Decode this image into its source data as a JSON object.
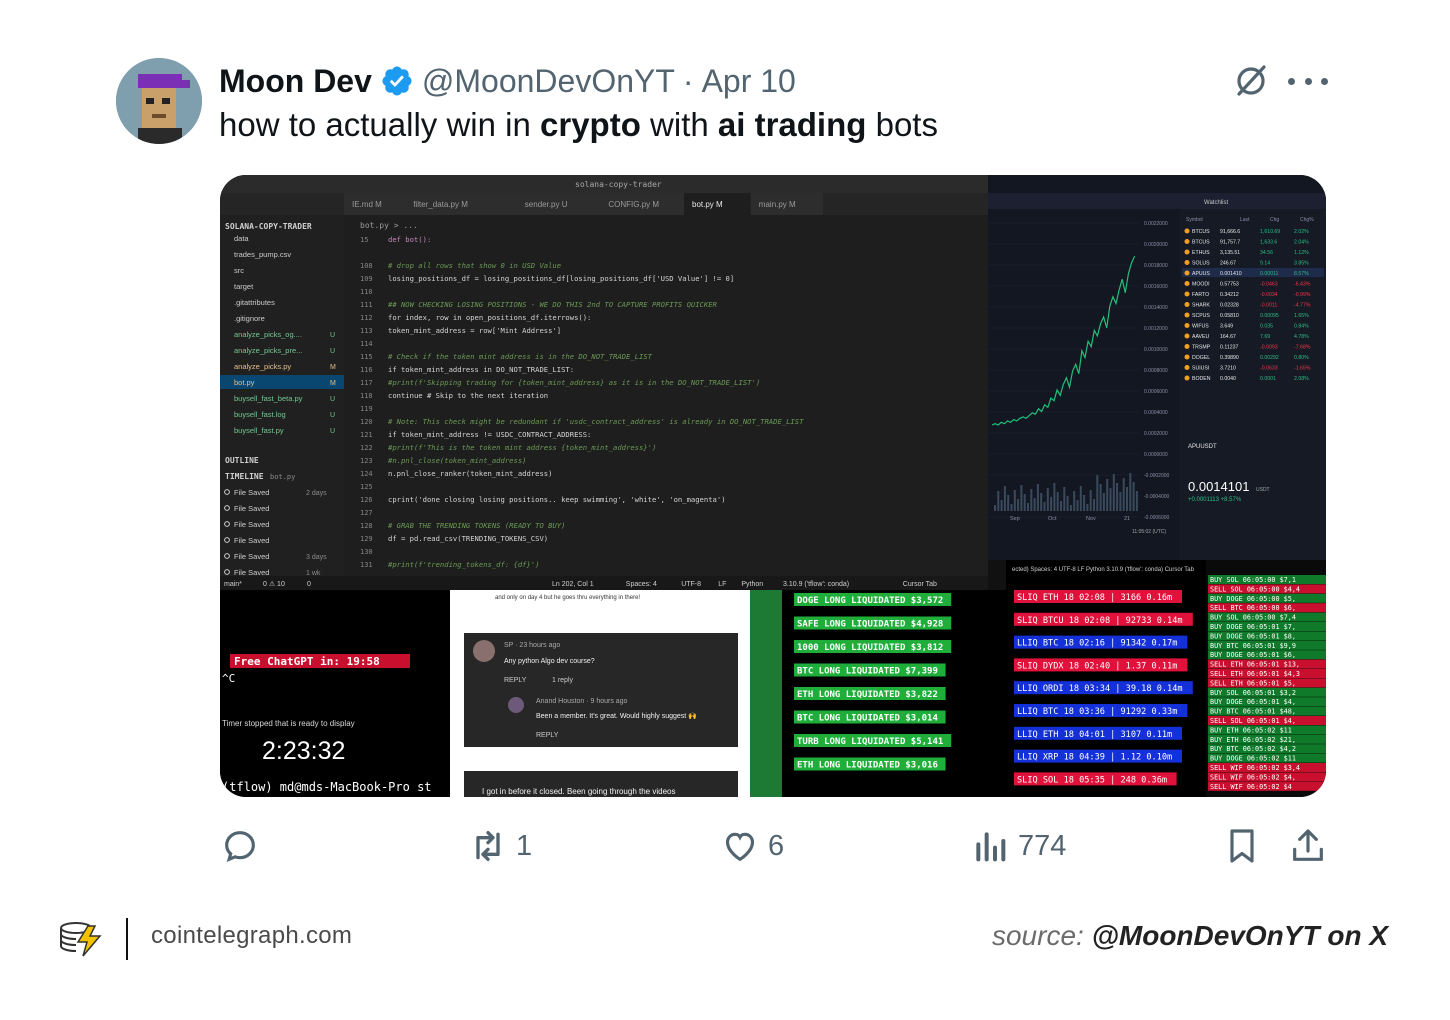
{
  "tweet": {
    "display_name": "Moon Dev",
    "handle": "@MoonDevOnYT",
    "separator": "·",
    "date": "Apr 10",
    "text_parts": [
      "how to actually win in ",
      "crypto",
      " with ",
      "ai trading",
      " bots"
    ]
  },
  "media": {
    "editor": {
      "window_title": "solana-copy-trader",
      "explorer_title": "SOLANA-COPY-TRADER",
      "tabs": [
        "IE.md M",
        "filter_data.py M",
        "sender.py U",
        "CONFIG.py M",
        "bot.py M",
        "main.py M"
      ],
      "breadcrumb": "bot.py > ...",
      "files": [
        {
          "name": "data",
          "badge": ""
        },
        {
          "name": "trades_pump.csv",
          "badge": ""
        },
        {
          "name": "src",
          "badge": ""
        },
        {
          "name": "target",
          "badge": ""
        },
        {
          "name": ".gitattributes",
          "badge": ""
        },
        {
          "name": ".gitignore",
          "badge": ""
        },
        {
          "name": "analyze_picks_og....",
          "badge": "U"
        },
        {
          "name": "analyze_picks_pre...",
          "badge": "U"
        },
        {
          "name": "analyze_picks.py",
          "badge": "M"
        },
        {
          "name": "bot.py",
          "badge": "M"
        },
        {
          "name": "buysell_fast_beta.py",
          "badge": "U"
        },
        {
          "name": "buysell_fast.log",
          "badge": "U"
        },
        {
          "name": "buysell_fast.py",
          "badge": "U"
        }
      ],
      "outline_label": "OUTLINE",
      "timeline_label": "TIMELINE",
      "timeline_file": "bot.py",
      "timeline": [
        {
          "label": "File Saved",
          "when": "2 days"
        },
        {
          "label": "File Saved",
          "when": ""
        },
        {
          "label": "File Saved",
          "when": ""
        },
        {
          "label": "File Saved",
          "when": ""
        },
        {
          "label": "File Saved",
          "when": "3 days"
        },
        {
          "label": "File Saved",
          "when": "1 wk"
        }
      ],
      "code": [
        {
          "n": "15",
          "t": "def bot():",
          "c": "kw"
        },
        {
          "n": "",
          "t": "",
          "c": ""
        },
        {
          "n": "108",
          "t": "    # drop all rows that show 0 in USD Value",
          "c": "cm"
        },
        {
          "n": "109",
          "t": "    losing_positions_df = losing_positions_df[losing_positions_df['USD Value'] != 0]",
          "c": "tx"
        },
        {
          "n": "110",
          "t": "",
          "c": ""
        },
        {
          "n": "111",
          "t": "## NOW CHECKING LOSING POSITIONS - WE DO THIS 2nd TO CAPTURE PROFITS QUICKER",
          "c": "cm"
        },
        {
          "n": "112",
          "t": "    for index, row in open_positions_df.iterrows():",
          "c": "tx"
        },
        {
          "n": "113",
          "t": "        token_mint_address = row['Mint Address']",
          "c": "tx"
        },
        {
          "n": "114",
          "t": "",
          "c": ""
        },
        {
          "n": "115",
          "t": "        # Check if the token mint address is in the DO_NOT_TRADE_LIST",
          "c": "cm"
        },
        {
          "n": "116",
          "t": "        if token_mint_address in DO_NOT_TRADE_LIST:",
          "c": "tx"
        },
        {
          "n": "117",
          "t": "            #print(f'Skipping trading for {token_mint_address} as it is in the DO_NOT_TRADE_LIST')",
          "c": "cm"
        },
        {
          "n": "118",
          "t": "            continue  # Skip to the next iteration",
          "c": "tx"
        },
        {
          "n": "119",
          "t": "",
          "c": ""
        },
        {
          "n": "120",
          "t": "        # Note: This check might be redundant if 'usdc_contract_address' is already in DO_NOT_TRADE_LIST",
          "c": "cm"
        },
        {
          "n": "121",
          "t": "        if token_mint_address != USDC_CONTRACT_ADDRESS:",
          "c": "tx"
        },
        {
          "n": "122",
          "t": "            #print(f'This is the token mint address {token_mint_address}')",
          "c": "cm"
        },
        {
          "n": "123",
          "t": "            #n.pnl_close(token_mint_address)",
          "c": "cm"
        },
        {
          "n": "124",
          "t": "            n.pnl_close_ranker(token_mint_address)",
          "c": "tx"
        },
        {
          "n": "125",
          "t": "",
          "c": ""
        },
        {
          "n": "126",
          "t": "    cprint('done closing losing positions.. keep swimming', 'white', 'on_magenta')",
          "c": "tx"
        },
        {
          "n": "127",
          "t": "",
          "c": ""
        },
        {
          "n": "128",
          "t": "    # GRAB THE TRENDING TOKENS (READY TO BUY)",
          "c": "cm"
        },
        {
          "n": "129",
          "t": "    df = pd.read_csv(TRENDING_TOKENS_CSV)",
          "c": "tx"
        },
        {
          "n": "130",
          "t": "",
          "c": ""
        },
        {
          "n": "131",
          "t": "    #print(f'trending_tokens_df: {df}')",
          "c": "cm"
        }
      ],
      "status_left": [
        "main*",
        "0 ⚠ 10",
        "0"
      ],
      "status_right": [
        "Ln 202, Col 1",
        "Spaces: 4",
        "UTF-8",
        "LF",
        "Python",
        "3.10.9 ('tflow': conda)",
        "Cursor Tab"
      ]
    },
    "chart_panel": {
      "watchlist_title": "Watchlist",
      "columns": [
        "Symbol",
        "Last",
        "Chg",
        "Chg%"
      ],
      "watchlist": [
        {
          "s": "BTCUS",
          "l": "91,666.6",
          "c": "1,610.69",
          "p": "2.02%"
        },
        {
          "s": "BTCUS",
          "l": "91,757.7",
          "c": "1,633.6",
          "p": "2.04%"
        },
        {
          "s": "ETHUS",
          "l": "3,135.51",
          "c": "34.56",
          "p": "1.12%"
        },
        {
          "s": "SOLUS",
          "l": "246.67",
          "c": "9.14",
          "p": "3.85%"
        },
        {
          "s": "APUUS",
          "l": "0.001410",
          "c": "0.00011",
          "p": "8.57%"
        },
        {
          "s": "MOODI",
          "l": "0.57753",
          "c": "-0.0463",
          "p": "-6.43%"
        },
        {
          "s": "FARTO",
          "l": "0.34212",
          "c": "-0.0034",
          "p": "-0.99%"
        },
        {
          "s": "SHARK",
          "l": "0.02328",
          "c": "-0.0011",
          "p": "-4.77%"
        },
        {
          "s": "SCPUS",
          "l": "0.05810",
          "c": "0.00095",
          "p": "1.65%"
        },
        {
          "s": "WIFUS",
          "l": "3.649",
          "c": "0.035",
          "p": "0.84%"
        },
        {
          "s": "AAVEU",
          "l": "164.67",
          "c": "7.69",
          "p": "4.78%"
        },
        {
          "s": "TRSMP",
          "l": "0.11237",
          "c": "-0.0093",
          "p": "-7.68%"
        },
        {
          "s": "DOGEL",
          "l": "0.39890",
          "c": "0.00292",
          "p": "0.80%"
        },
        {
          "s": "SUIUSI",
          "l": "3.7210",
          "c": "-0.0633",
          "p": "-1.65%"
        },
        {
          "s": "BODEN",
          "l": "0.0040",
          "c": "0.0001",
          "p": "2.08%"
        }
      ],
      "selected_symbol": "APUUSDT",
      "price": "0.0014101",
      "price_unit": "USDT",
      "price_change": "+0.0001113 +8.57%",
      "axis_labels": [
        "0.0022000",
        "0.0020000",
        "0.0018000",
        "0.0016000",
        "0.0014000",
        "0.0012000",
        "0.0010000",
        "0.0008000",
        "0.0006000",
        "0.0004000",
        "0.0002000",
        "0.0000000",
        "-0.0002000",
        "-0.0004000",
        "-0.0006000"
      ],
      "time_labels": [
        "Sep",
        "Oct",
        "Nov",
        "21"
      ],
      "clock": "11:05:02 (UTC)"
    },
    "terminal": {
      "banner": "Free ChatGPT in: 19:58",
      "ctrl_c": "^C",
      "overlay_text": "Timer stopped that is ready to display",
      "timer": "2:23:32",
      "prompt": "(tflow) md@mds-MacBook-Pro st"
    },
    "youtube": {
      "top_text": "and only on day 4 but he goes thru everything in there!",
      "comment1_author": "SP · 23 hours ago",
      "comment1_text": "Any python Algo dev course?",
      "reply_label": "REPLY",
      "replies_label": "1 reply",
      "comment2_author": "Anand Houston · 9 hours ago",
      "comment2_text": "Been a member. It's great. Would highly suggest 🙌",
      "reply2_label": "REPLY",
      "bottom_text": "I got in before it closed. Been going through the videos"
    },
    "liquidations": [
      "DOGE LONG LIQUIDATED $3,572",
      "SAFE LONG LIQUIDATED $4,928",
      "1000 LONG LIQUIDATED $3,812",
      "BTC LONG LIQUIDATED $7,399",
      "ETH LONG LIQUIDATED $3,822",
      "BTC LONG LIQUIDATED $3,014",
      "TURB LONG LIQUIDATED $5,141",
      "ETH LONG LIQUIDATED $3,016"
    ],
    "trades_header": "ected)  Spaces: 4  UTF-8  LF  Python  3.10.9 ('tflow': conda)  Cursor Tab",
    "trades": [
      {
        "t": "SLIQ ETH 18 02:08 | 3166 0.16m",
        "side": "s"
      },
      {
        "t": "SLIQ BTCU 18 02:08 | 92733 0.14m",
        "side": "s"
      },
      {
        "t": "LLIQ BTC 18 02:16 | 91342 0.17m",
        "side": "l"
      },
      {
        "t": "SLIQ DYDX 18 02:40 | 1.37 0.11m",
        "side": "s"
      },
      {
        "t": "LLIQ ORDI 18 03:34 | 39.18 0.14m",
        "side": "l"
      },
      {
        "t": "LLIQ BTC 18 03:36 | 91292 0.33m",
        "side": "l"
      },
      {
        "t": "LLIQ ETH 18 04:01 | 3107 0.11m",
        "side": "l"
      },
      {
        "t": "LLIQ XRP 18 04:39 | 1.12 0.10m",
        "side": "l"
      },
      {
        "t": "SLIQ SOL 18 05:35 | 248 0.36m",
        "side": "s"
      }
    ],
    "tape": [
      {
        "t": "BUY SOL 06:05:00 $7,1",
        "side": "b"
      },
      {
        "t": "SELL SOL 06:05:00 $4,4",
        "side": "s"
      },
      {
        "t": "BUY DOGE 06:05:00 $5,",
        "side": "b"
      },
      {
        "t": "SELL BTC 06:05:00 $6,",
        "side": "s"
      },
      {
        "t": "BUY SOL 06:05:00 $7,4",
        "side": "b"
      },
      {
        "t": "BUY DOGE 06:05:01 $7,",
        "side": "b"
      },
      {
        "t": "BUY DOGE 06:05:01 $8,",
        "side": "b"
      },
      {
        "t": "BUY BTC 06:05:01 $9,9",
        "side": "b"
      },
      {
        "t": "BUY DOGE 06:05:01 $6,",
        "side": "b"
      },
      {
        "t": "SELL ETH 06:05:01 $13,",
        "side": "s"
      },
      {
        "t": "SELL ETH 06:05:01 $4,3",
        "side": "s"
      },
      {
        "t": "SELL ETH 06:05:01 $5,",
        "side": "s"
      },
      {
        "t": "BUY SOL 06:05:01 $3,2",
        "side": "b"
      },
      {
        "t": "BUY DOGE 06:05:01 $4,",
        "side": "b"
      },
      {
        "t": "BUY BTC 06:05:01 $48,",
        "side": "b"
      },
      {
        "t": "SELL SOL 06:05:01 $4,",
        "side": "s"
      },
      {
        "t": "BUY ETH 06:05:02 $11",
        "side": "b"
      },
      {
        "t": "BUY ETH 06:05:02 $21,",
        "side": "b"
      },
      {
        "t": "BUY BTC 06:05:02 $4,2",
        "side": "b"
      },
      {
        "t": "BUY DOGE 06:05:02 $11",
        "side": "b"
      },
      {
        "t": "SELL WIF 06:05:02 $3,4",
        "side": "s"
      },
      {
        "t": "SELL WIF 06:05:02 $4,",
        "side": "s"
      },
      {
        "t": "SELL WIF 06:05:02 $4",
        "side": "s"
      }
    ]
  },
  "actions": {
    "reply_count": "",
    "retweet_count": "1",
    "like_count": "6",
    "views_count": "774"
  },
  "footer": {
    "site": "cointelegraph.com",
    "source_prefix": "source: ",
    "source_handle": "@MoonDevOnYT on X"
  },
  "colors": {
    "verified": "#1d9bf0",
    "text": "#0f1419",
    "muted": "#536471",
    "liq_green": "#1fae3a",
    "sliq_red": "#e0113a",
    "lliq_blue": "#1430d8",
    "tape_red": "#c8102e"
  }
}
